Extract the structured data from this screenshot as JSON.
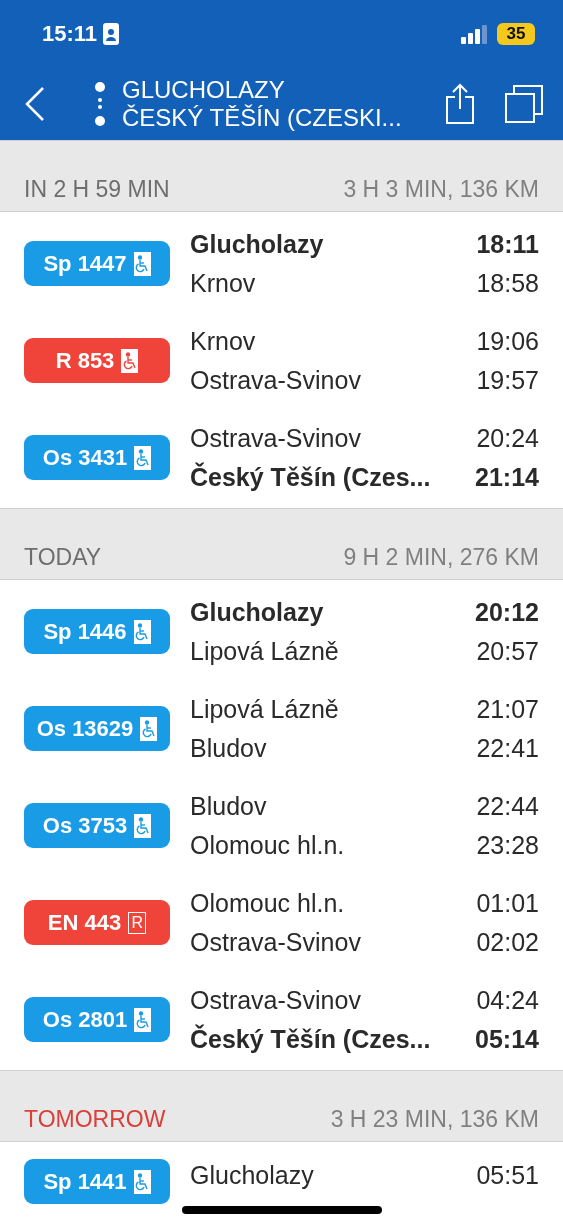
{
  "status_bar": {
    "time": "15:11",
    "battery": "35"
  },
  "header": {
    "from": "GLUCHOLAZY",
    "to": "ČESKÝ TĚŠÍN (CZESKI..."
  },
  "sections": [
    {
      "when": "IN 2 H 59 MIN",
      "color": "#6e6e6e",
      "summary": "3 H 3 MIN, 136 KM",
      "legs": [
        {
          "train": "Sp 1447",
          "color": "#1a9be6",
          "amenity": {
            "kind": "wheelchair"
          },
          "stops": [
            {
              "station": "Glucholazy",
              "time": "18:11",
              "emphasized": true
            },
            {
              "station": "Krnov",
              "time": "18:58",
              "emphasized": false
            }
          ]
        },
        {
          "train": "R 853",
          "color": "#f0443a",
          "amenity": {
            "kind": "wheelchair"
          },
          "stops": [
            {
              "station": "Krnov",
              "time": "19:06",
              "emphasized": false
            },
            {
              "station": "Ostrava-Svinov",
              "time": "19:57",
              "emphasized": false
            }
          ]
        },
        {
          "train": "Os 3431",
          "color": "#1a9be6",
          "amenity": {
            "kind": "wheelchair"
          },
          "stops": [
            {
              "station": "Ostrava-Svinov",
              "time": "20:24",
              "emphasized": false
            },
            {
              "station": "Český Těšín (Czes...",
              "time": "21:14",
              "emphasized": true
            }
          ]
        }
      ]
    },
    {
      "when": "TODAY",
      "color": "#6e6e6e",
      "summary": "9 H 2 MIN, 276 KM",
      "legs": [
        {
          "train": "Sp 1446",
          "color": "#1a9be6",
          "amenity": {
            "kind": "wheelchair"
          },
          "stops": [
            {
              "station": "Glucholazy",
              "time": "20:12",
              "emphasized": true
            },
            {
              "station": "Lipová Lázně",
              "time": "20:57",
              "emphasized": false
            }
          ]
        },
        {
          "train": "Os 13629",
          "color": "#1a9be6",
          "amenity": {
            "kind": "wheelchair"
          },
          "stops": [
            {
              "station": "Lipová Lázně",
              "time": "21:07",
              "emphasized": false
            },
            {
              "station": "Bludov",
              "time": "22:41",
              "emphasized": false
            }
          ]
        },
        {
          "train": "Os 3753",
          "color": "#1a9be6",
          "amenity": {
            "kind": "wheelchair"
          },
          "stops": [
            {
              "station": "Bludov",
              "time": "22:44",
              "emphasized": false
            },
            {
              "station": "Olomouc hl.n.",
              "time": "23:28",
              "emphasized": false
            }
          ]
        },
        {
          "train": "EN 443",
          "color": "#f0443a",
          "amenity": {
            "kind": "reservation",
            "text": "R"
          },
          "stops": [
            {
              "station": "Olomouc hl.n.",
              "time": "01:01",
              "emphasized": false
            },
            {
              "station": "Ostrava-Svinov",
              "time": "02:02",
              "emphasized": false
            }
          ]
        },
        {
          "train": "Os 2801",
          "color": "#1a9be6",
          "amenity": {
            "kind": "wheelchair"
          },
          "stops": [
            {
              "station": "Ostrava-Svinov",
              "time": "04:24",
              "emphasized": false
            },
            {
              "station": "Český Těšín (Czes...",
              "time": "05:14",
              "emphasized": true
            }
          ]
        }
      ]
    },
    {
      "when": "TOMORROW",
      "color": "#d9403a",
      "summary": "3 H 23 MIN, 136 KM",
      "legs": [
        {
          "train": "Sp 1441",
          "color": "#1a9be6",
          "amenity": {
            "kind": "wheelchair"
          },
          "stops": [
            {
              "station": "Glucholazy",
              "time": "05:51",
              "emphasized": false
            }
          ]
        }
      ]
    }
  ]
}
